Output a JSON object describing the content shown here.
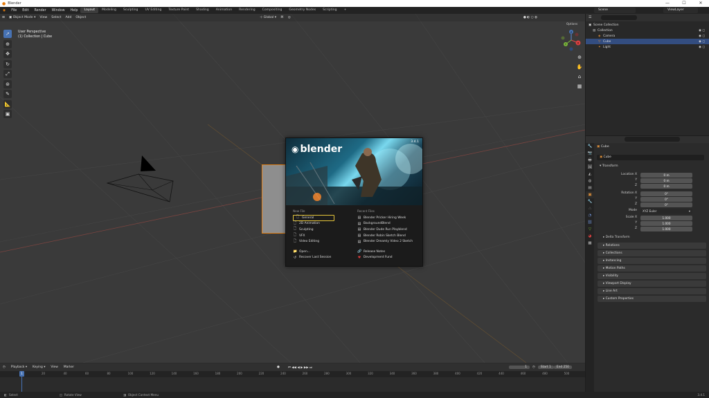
{
  "window": {
    "title": "Blender",
    "controls": [
      "—",
      "☐",
      "✕"
    ]
  },
  "menus": [
    "File",
    "Edit",
    "Render",
    "Window",
    "Help"
  ],
  "workspaces": [
    "Layout",
    "Modeling",
    "Sculpting",
    "UV Editing",
    "Texture Paint",
    "Shading",
    "Animation",
    "Rendering",
    "Compositing",
    "Geometry Nodes",
    "Scripting"
  ],
  "active_workspace": "Layout",
  "scene": {
    "label": "Scene",
    "layer": "ViewLayer"
  },
  "viewport": {
    "mode": "Object Mode",
    "menus": [
      "View",
      "Select",
      "Add",
      "Object"
    ],
    "orientation": "Global",
    "overlay_label": "Options",
    "info_line1": "User Perspective",
    "info_line2": "(1) Collection | Cube",
    "tools": [
      "select-box-icon",
      "cursor-icon",
      "move-icon",
      "rotate-icon",
      "scale-icon",
      "transform-icon",
      "annotate-icon",
      "measure-icon",
      "add-cube-icon"
    ]
  },
  "gizmo": {
    "x": "X",
    "y": "Y",
    "z": "Z"
  },
  "splash": {
    "logo": "blender",
    "version": "3.4.1",
    "new_file_heading": "New File",
    "new_file": [
      "General",
      "2D Animation",
      "Sculpting",
      "VFX",
      "Video Editing"
    ],
    "open": "Open...",
    "recover": "Recover Last Session",
    "recent_heading": "Recent Files",
    "recent": [
      "Blender Pricker Hiring Week",
      "BackgroundBlend",
      "Blender Dude Run Playblend",
      "Blender Robin Sketch Blend",
      "Blender Dreamly Video 2 Sketch"
    ],
    "release_notes": "Release Notes",
    "dev_fund": "Development Fund"
  },
  "outliner": {
    "rows": [
      {
        "label": "Scene Collection",
        "indent": 0,
        "icon": "▣"
      },
      {
        "label": "Collection",
        "indent": 1,
        "icon": "▤"
      },
      {
        "label": "Camera",
        "indent": 2,
        "icon": "◈"
      },
      {
        "label": "Cube",
        "indent": 2,
        "icon": "▽",
        "selected": true
      },
      {
        "label": "Light",
        "indent": 2,
        "icon": "✦"
      }
    ]
  },
  "properties": {
    "object_name": "Cube",
    "data_name": "Cube",
    "transform_heading": "Transform",
    "location_label": "Location X",
    "location": [
      "0 m",
      "0 m",
      "0 m"
    ],
    "rotation_label": "Rotation X",
    "rotation": [
      "0°",
      "0°",
      "0°"
    ],
    "mode_label": "Mode",
    "mode_value": "XYZ Euler",
    "scale_label": "Scale X",
    "scale": [
      "1.000",
      "1.000",
      "1.000"
    ],
    "y_label": "Y",
    "z_label": "Z",
    "delta_label": "Delta Transform",
    "panels": [
      "Relations",
      "Collections",
      "Instancing",
      "Motion Paths",
      "Visibility",
      "Viewport Display",
      "Line Art",
      "Custom Properties"
    ],
    "tabs": [
      "tool-tab-icon",
      "render-tab-icon",
      "output-tab-icon",
      "view-layer-tab-icon",
      "scene-tab-icon",
      "world-tab-icon",
      "collection-tab-icon",
      "object-tab-icon",
      "modifier-tab-icon",
      "particles-tab-icon",
      "physics-tab-icon",
      "constraints-tab-icon",
      "data-tab-icon",
      "material-tab-icon",
      "texture-tab-icon"
    ]
  },
  "timeline": {
    "menus": [
      "Playback",
      "Keying",
      "View",
      "Marker"
    ],
    "current_frame": "1",
    "start_label": "Start",
    "start": "1",
    "end_label": "End",
    "end": "250",
    "ticks": [
      "0",
      "20",
      "40",
      "60",
      "80",
      "100",
      "120",
      "140",
      "160",
      "180",
      "200",
      "220",
      "240",
      "260",
      "280",
      "300",
      "320",
      "340",
      "360",
      "380",
      "400",
      "420",
      "440",
      "460",
      "480",
      "500",
      "520",
      "540",
      "560",
      "580",
      "600",
      "620",
      "640",
      "660",
      "680",
      "700",
      "720",
      "740",
      "760",
      "780",
      "800"
    ]
  },
  "status": {
    "select": "Select",
    "rotate": "Rotate View",
    "context": "Object Context Menu",
    "version": "3.4.1"
  }
}
